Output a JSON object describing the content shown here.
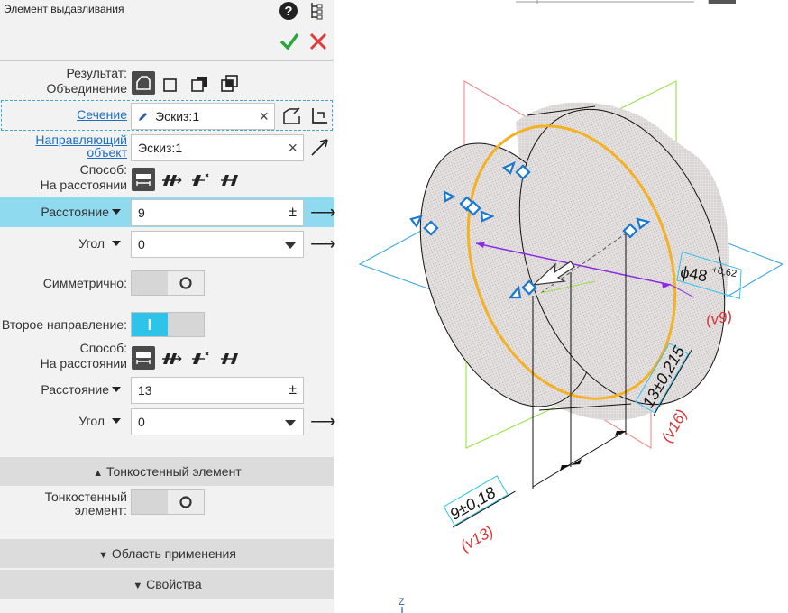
{
  "panel": {
    "title": "Элемент выдавливания",
    "result": {
      "label": "Результат:",
      "value": "Объединение"
    },
    "section_field": {
      "label": "Сечение",
      "value": "Эскиз:1"
    },
    "guide_field": {
      "label_line1": "Направляющий",
      "label_line2": "объект",
      "value": "Эскиз:1"
    },
    "method1": {
      "label": "Способ:",
      "value": "На расстоянии"
    },
    "distance1": {
      "label": "Расстояние",
      "value": "9",
      "pm": "±"
    },
    "angle1": {
      "label": "Угол",
      "value": "0"
    },
    "symmetric": {
      "label": "Симметрично:"
    },
    "second_direction": {
      "label": "Второе направление:"
    },
    "method2": {
      "label": "Способ:",
      "value": "На расстоянии"
    },
    "distance2": {
      "label": "Расстояние",
      "value": "13",
      "pm": "±"
    },
    "angle2": {
      "label": "Угол",
      "value": "0"
    },
    "thinwall_section": "Тонкостенный элемент",
    "thinwall": {
      "label_line1": "Тонкостенный",
      "label_line2": "элемент:"
    },
    "scope_section": "Область применения",
    "props_section": "Свойства",
    "colors": {
      "accent": "#8fdaef",
      "toggle_on": "#2ec4ea",
      "ok": "#2aa63a",
      "cancel": "#e03c3c"
    }
  },
  "viewport": {
    "dim_diameter": "ϕ48",
    "dim_diameter_tol": "+0,62",
    "dim_diameter_var": "(v9)",
    "dim_13": "13±0,215",
    "dim_13_var": "(v16)",
    "dim_9": "9±0,18",
    "dim_9_var": "(v13)",
    "axis_z": "Z"
  }
}
